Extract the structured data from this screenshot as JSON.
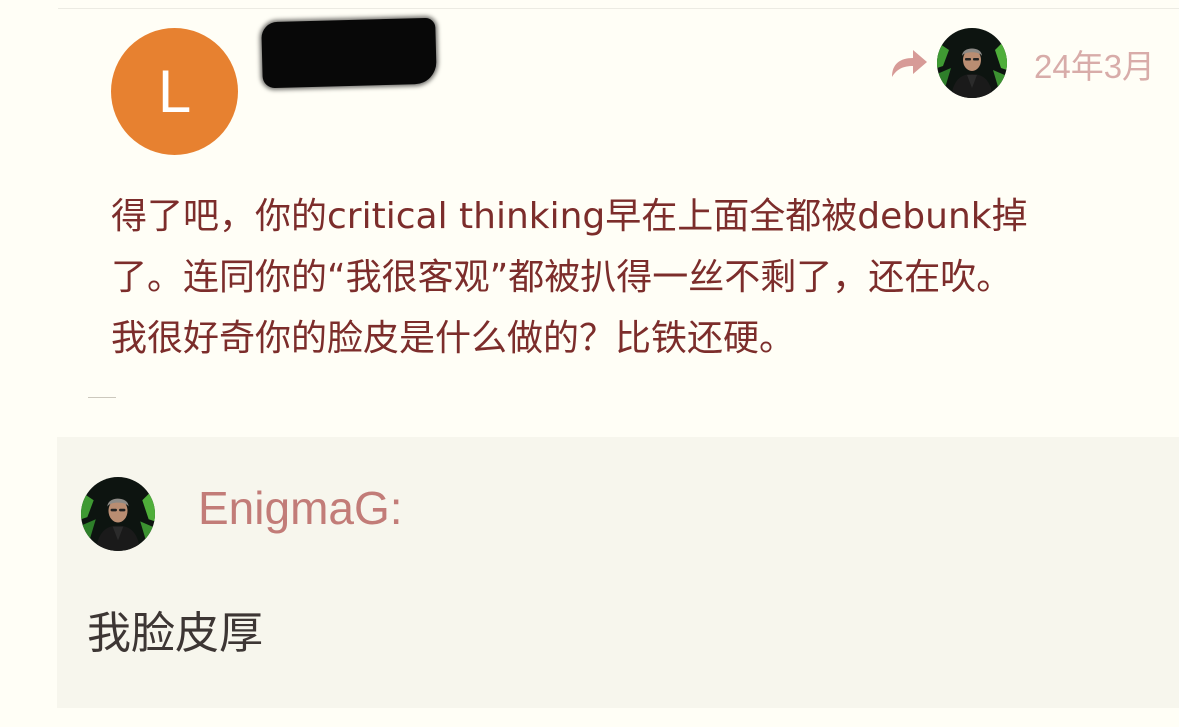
{
  "post": {
    "author_initial": "L",
    "timestamp": "24年3月",
    "body_lines": [
      "得了吧，你的critical thinking早在上面全都被debunk掉",
      "了。连同你的“我很客观”都被扒得一丝不剩了，还在吹。",
      "我很好奇你的脸皮是什么做的？比铁还硬。"
    ],
    "reply_icon": "reply-arrow-icon"
  },
  "quote": {
    "username": "EnigmaG:",
    "text": "我脸皮厚"
  },
  "colors": {
    "page_background": "#fffef6",
    "quote_background": "#f7f6ed",
    "author_avatar": "#e78130",
    "body_text": "#7c2d2b",
    "username": "#c27c78",
    "timestamp": "#d8aca9",
    "reply_icon": "#d79b97"
  }
}
